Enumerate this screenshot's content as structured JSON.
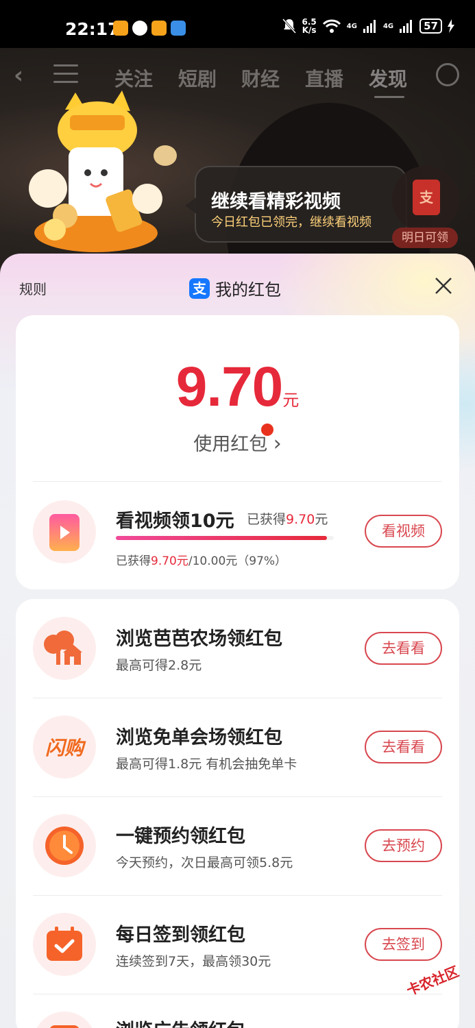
{
  "status_bar": {
    "time": "22:17",
    "net_speed_value": "6.5",
    "net_speed_unit": "K/s",
    "signal1": "4G",
    "signal2": "4G",
    "battery": "57"
  },
  "top_nav": {
    "tabs": [
      "关注",
      "短剧",
      "财经",
      "直播",
      "发现"
    ],
    "active_tab": "发现"
  },
  "tooltip": {
    "title": "继续看精彩视频",
    "subtitle": "今日红包已领完，继续看视频"
  },
  "redpack_widget": {
    "icon_text": "支",
    "label": "明日可领"
  },
  "sheet": {
    "rules": "规则",
    "title": "我的红包",
    "alipay_glyph": "支"
  },
  "balance": {
    "amount": "9.70",
    "unit": "元",
    "use_link": "使用红包",
    "arrow": "›"
  },
  "video_task": {
    "title": "看视频领10元",
    "earned_prefix": "已获得",
    "earned_value": "9.70",
    "earned_unit": "元",
    "progress_fraction": 0.97,
    "progress_prefix": "已获得",
    "progress_value": "9.70元",
    "progress_suffix": "/10.00元（97%）",
    "button": "看视频"
  },
  "tasks": [
    {
      "title": "浏览芭芭农场领红包",
      "subtitle": "最高可得2.8元",
      "button": "去看看",
      "icon": "farm-icon"
    },
    {
      "title": "浏览免单会场领红包",
      "subtitle": "最高可得1.8元 有机会抽免单卡",
      "button": "去看看",
      "icon": "flash-buy-icon",
      "icon_text": "闪购"
    },
    {
      "title": "一键预约领红包",
      "subtitle": "今天预约，次日最高可领5.8元",
      "button": "去预约",
      "icon": "clock-icon"
    },
    {
      "title": "每日签到领红包",
      "subtitle": "连续签到7天，最高领30元",
      "button": "去签到",
      "icon": "calendar-check-icon"
    },
    {
      "title": "浏览广告领红包",
      "subtitle": "",
      "button": "",
      "icon": "ad-icon"
    }
  ],
  "watermark": "卡农社区",
  "colors": {
    "accent_red": "#e6293a",
    "button_border": "#d8474f",
    "alipay_blue": "#1677ff"
  }
}
